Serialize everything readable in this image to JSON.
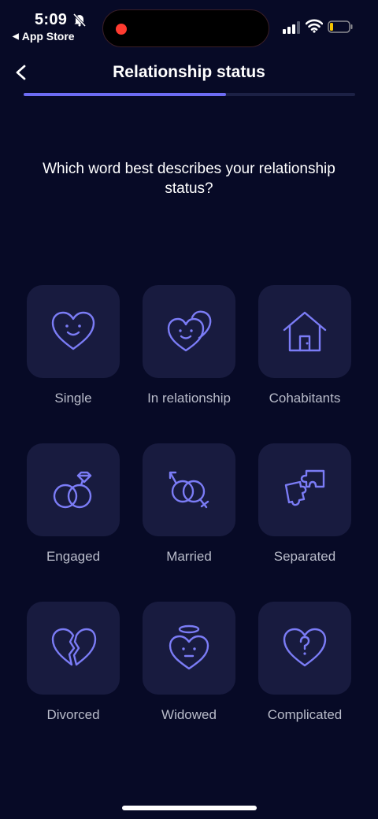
{
  "status_bar": {
    "time": "5:09",
    "back_app": "App Store",
    "back_arrow": "◀"
  },
  "nav": {
    "title": "Relationship status",
    "progress": 0.61
  },
  "question": "Which word best describes your relationship status?",
  "options": [
    {
      "label": "Single",
      "icon": "heart-smile-icon"
    },
    {
      "label": "In relationship",
      "icon": "two-hearts-icon"
    },
    {
      "label": "Cohabitants",
      "icon": "house-icon"
    },
    {
      "label": "Engaged",
      "icon": "rings-diamond-icon"
    },
    {
      "label": "Married",
      "icon": "gender-rings-icon"
    },
    {
      "label": "Separated",
      "icon": "puzzle-pieces-icon"
    },
    {
      "label": "Divorced",
      "icon": "broken-heart-icon"
    },
    {
      "label": "Widowed",
      "icon": "halo-heart-icon"
    },
    {
      "label": "Complicated",
      "icon": "question-heart-icon"
    }
  ],
  "colors": {
    "background": "#070a26",
    "tile": "#181b3f",
    "accent": "#7b7cf6",
    "label": "#b9bcca"
  }
}
